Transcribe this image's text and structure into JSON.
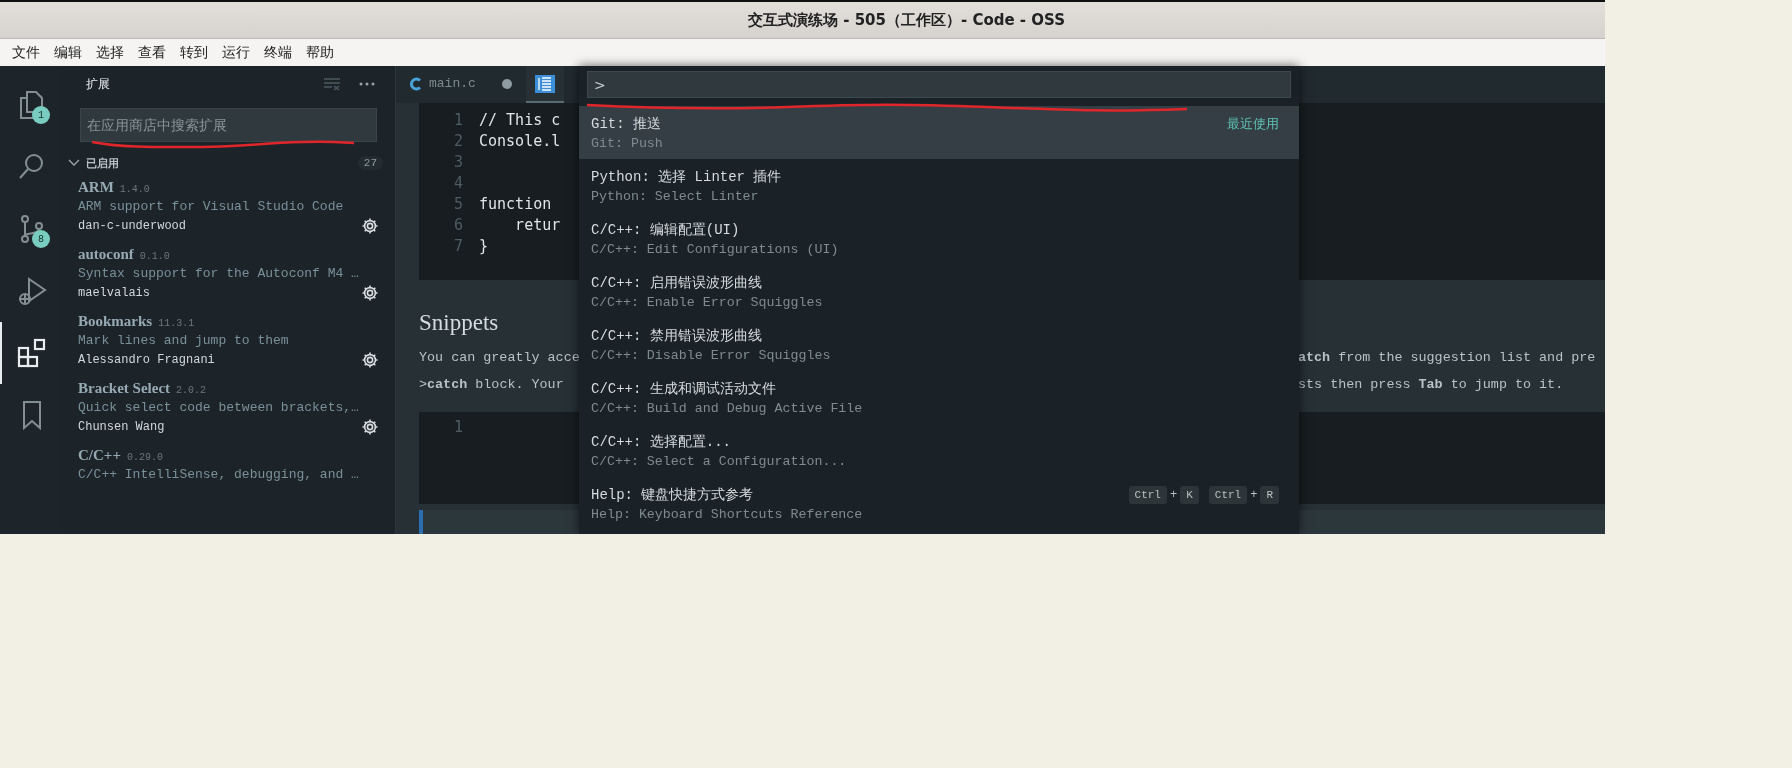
{
  "window": {
    "title": "交互式演练场 - 505（工作区）- Code - OSS"
  },
  "menu": [
    "文件",
    "编辑",
    "选择",
    "查看",
    "转到",
    "运行",
    "终端",
    "帮助"
  ],
  "activity_bar": [
    {
      "kind": "files",
      "selected": false,
      "badge": "1"
    },
    {
      "kind": "search",
      "selected": false
    },
    {
      "kind": "source-control",
      "selected": false,
      "badge": "8"
    },
    {
      "kind": "run-debug",
      "selected": false
    },
    {
      "kind": "extensions",
      "selected": true
    },
    {
      "kind": "bookmarks",
      "selected": false
    }
  ],
  "sidebar": {
    "title": "扩展",
    "search": {
      "placeholder": "在应用商店中搜索扩展",
      "underlined": true
    },
    "section": {
      "title": "已启用",
      "expanded": true,
      "count": "27"
    },
    "extensions": [
      {
        "name": "ARM",
        "version": "1.4.0",
        "description": "ARM support for Visual Studio Code",
        "author": "dan-c-underwood"
      },
      {
        "name": "autoconf",
        "version": "0.1.0",
        "description": "Syntax support for the Autoconf M4 …",
        "author": "maelvalais"
      },
      {
        "name": "Bookmarks",
        "version": "11.3.1",
        "description": "Mark lines and jump to them",
        "author": "Alessandro Fragnani"
      },
      {
        "name": "Bracket Select",
        "version": "2.0.2",
        "description": "Quick select code between brackets,…",
        "author": "Chunsen Wang"
      },
      {
        "name": "C/C++",
        "version": "0.29.0",
        "description": "C/C++ IntelliSense, debugging, and …"
      }
    ]
  },
  "tabs": [
    {
      "kind": "c",
      "label": "main.c",
      "modified": true,
      "selected": false
    },
    {
      "kind": "preview",
      "selected": true
    }
  ],
  "editor": {
    "code_lines": [
      {
        "number": "1",
        "text": "// This c"
      },
      {
        "number": "2",
        "text": "Console.l"
      },
      {
        "number": "3"
      },
      {
        "number": "4"
      },
      {
        "number": "5",
        "text": "function"
      },
      {
        "number": "6",
        "text": "    retur"
      },
      {
        "number": "7",
        "text": "}"
      }
    ],
    "heading": "Snippets",
    "paragraph_lines": [
      {
        "left": "You can greatly acce",
        "right": "**atch** from the suggestion list and pre"
      },
      {
        "left": ">**catch** block. Your",
        "right": "sts then press **Tab** to jump to it."
      }
    ],
    "snippet_line_numbers": [
      "1"
    ]
  },
  "quick_open": {
    "input": {
      "value": ">",
      "underlined": true
    },
    "items": [
      {
        "label": "Git: 推送",
        "detail": "Git: Push",
        "selected": true,
        "tag": "最近使用"
      },
      {
        "label": "Python: 选择 Linter 插件",
        "detail": "Python: Select Linter",
        "selected": false
      },
      {
        "label": "C/C++: 编辑配置(UI)",
        "detail": "C/C++: Edit Configurations (UI)",
        "selected": false
      },
      {
        "label": "C/C++: 启用错误波形曲线",
        "detail": "C/C++: Enable Error Squiggles",
        "selected": false
      },
      {
        "label": "C/C++: 禁用错误波形曲线",
        "detail": "C/C++: Disable Error Squiggles",
        "selected": false
      },
      {
        "label": "C/C++: 生成和调试活动文件",
        "detail": "C/C++: Build and Debug Active File",
        "selected": false
      },
      {
        "label": "C/C++: 选择配置...",
        "detail": "C/C++: Select a Configuration...",
        "selected": false
      },
      {
        "label": "Help: 键盘快捷方式参考",
        "detail": "Help: Keyboard Shortcuts Reference",
        "selected": false,
        "keybinding": {
          "joiner": "+",
          "chords": [
            [
              "Ctrl",
              "K"
            ],
            [
              "Ctrl",
              "R"
            ]
          ]
        }
      }
    ]
  }
}
